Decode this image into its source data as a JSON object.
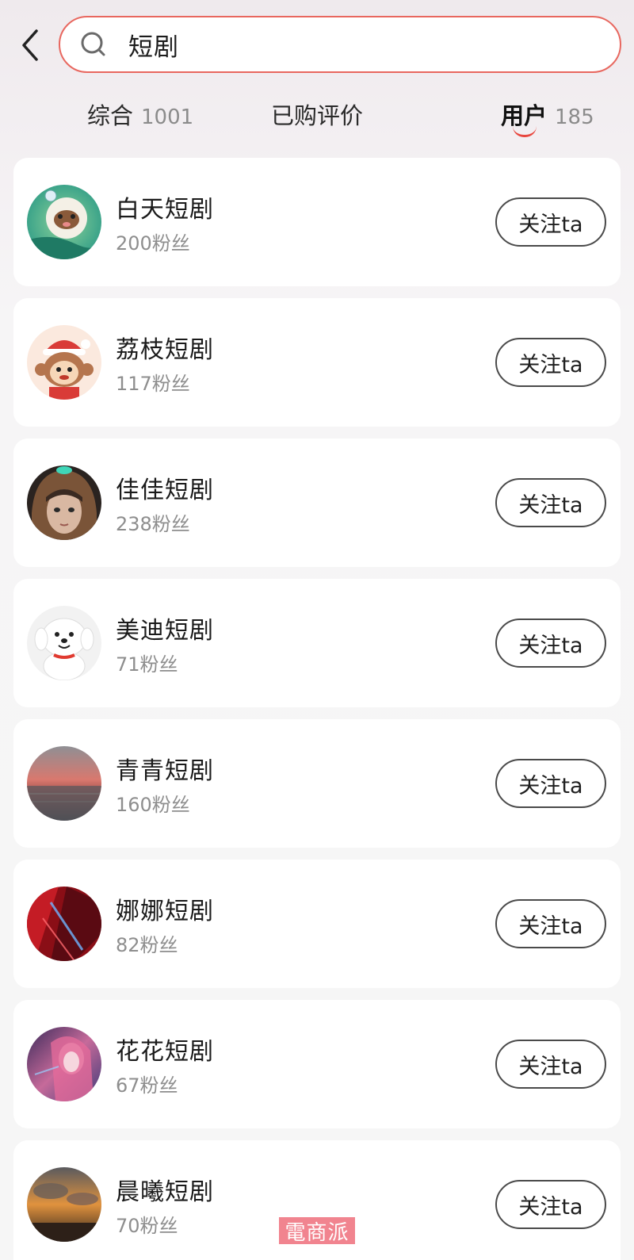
{
  "search": {
    "query": "短剧"
  },
  "tabs": [
    {
      "label": "综合",
      "count": "1001"
    },
    {
      "label": "已购评价",
      "count": ""
    },
    {
      "label": "用户",
      "count": "185"
    }
  ],
  "active_tab": "用户",
  "users": [
    {
      "name": "白天短剧",
      "fans": "200粉丝",
      "follow_label": "关注ta",
      "avatar": "cartoon-dog-green"
    },
    {
      "name": "荔枝短剧",
      "fans": "117粉丝",
      "follow_label": "关注ta",
      "avatar": "cartoon-monkey-santa"
    },
    {
      "name": "佳佳短剧",
      "fans": "238粉丝",
      "follow_label": "关注ta",
      "avatar": "girl-hood-portrait"
    },
    {
      "name": "美迪短剧",
      "fans": "71粉丝",
      "follow_label": "关注ta",
      "avatar": "white-dog-mascot"
    },
    {
      "name": "青青短剧",
      "fans": "160粉丝",
      "follow_label": "关注ta",
      "avatar": "sunset-sea"
    },
    {
      "name": "娜娜短剧",
      "fans": "82粉丝",
      "follow_label": "关注ta",
      "avatar": "red-abstract"
    },
    {
      "name": "花花短剧",
      "fans": "67粉丝",
      "follow_label": "关注ta",
      "avatar": "anime-girl-pink"
    },
    {
      "name": "晨曦短剧",
      "fans": "70粉丝",
      "follow_label": "关注ta",
      "avatar": "sunrise-clouds"
    }
  ],
  "watermark": "電商派",
  "colors": {
    "accent": "#e8473f",
    "search_border": "#e8675f",
    "muted_text": "#8e8e8e"
  }
}
